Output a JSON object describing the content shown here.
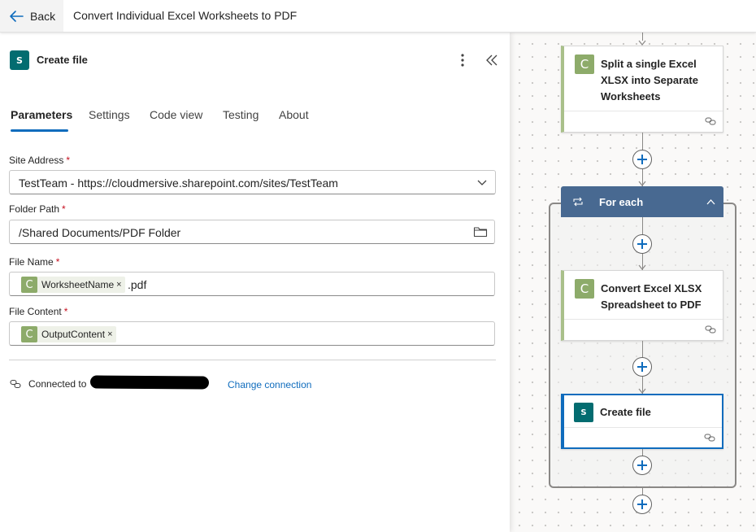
{
  "header": {
    "back_label": "Back",
    "flow_title": "Convert Individual Excel Worksheets to PDF"
  },
  "panel": {
    "title": "Create file",
    "icon": "sharepoint-icon",
    "tabs": [
      {
        "label": "Parameters",
        "active": true
      },
      {
        "label": "Settings"
      },
      {
        "label": "Code view"
      },
      {
        "label": "Testing"
      },
      {
        "label": "About"
      }
    ],
    "fields": {
      "site_address": {
        "label": "Site Address",
        "required": "*",
        "value": "TestTeam - https://cloudmersive.sharepoint.com/sites/TestTeam"
      },
      "folder_path": {
        "label": "Folder Path",
        "required": "*",
        "value": "/Shared Documents/PDF Folder"
      },
      "file_name": {
        "label": "File Name",
        "required": "*",
        "token_badge": "C",
        "token": "WorksheetName",
        "token_remove": "×",
        "suffix": ".pdf"
      },
      "file_content": {
        "label": "File Content",
        "required": "*",
        "token_badge": "C",
        "token": "OutputContent",
        "token_remove": "×"
      }
    },
    "connection": {
      "label": "Connected to",
      "change_label": "Change connection"
    }
  },
  "canvas": {
    "cards": {
      "split": {
        "badge": "C",
        "title_line1": "Split a single Excel",
        "title_line2": "XLSX into Separate",
        "title_line3": "Worksheets"
      },
      "foreach": {
        "title": "For each"
      },
      "convert": {
        "badge": "C",
        "title_line1": "Convert Excel XLSX",
        "title_line2": "Spreadsheet to PDF"
      },
      "create": {
        "badge": "S",
        "title": "Create file"
      }
    }
  },
  "colors": {
    "accent": "#0f6cbd",
    "sharepoint": "#036c70",
    "cloudmersive": "#8dab6a",
    "foreach_header": "#486991",
    "required": "#c50f1f"
  }
}
